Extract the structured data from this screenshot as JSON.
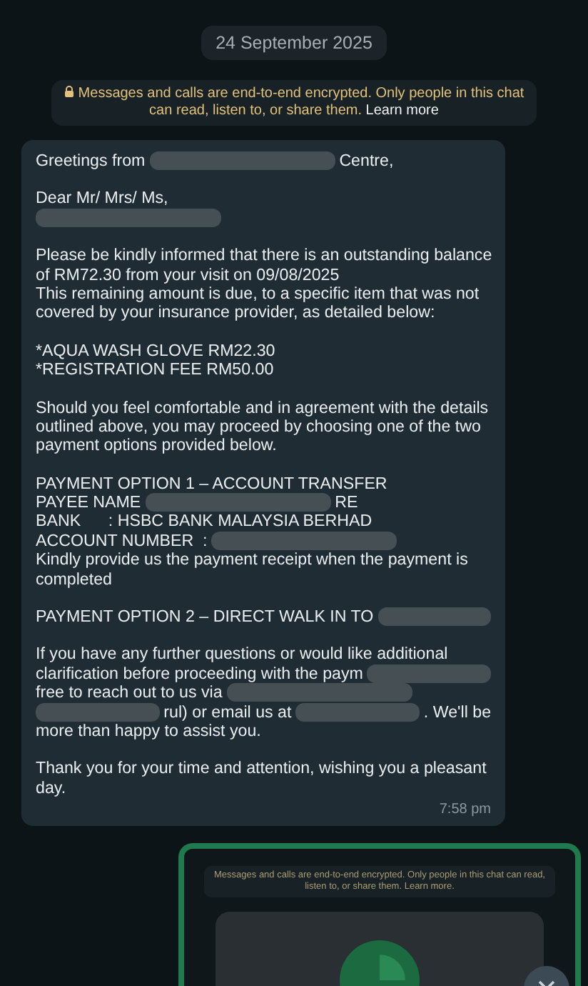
{
  "date_chip": "24 September 2025",
  "encryption_notice": {
    "text": "Messages and calls are end-to-end encrypted. Only people in this chat can read, listen to, or share them.",
    "link": "Learn more"
  },
  "message": {
    "paragraphs": [
      {
        "lines": [
          [
            {
              "kind": "text",
              "text": "Greetings from"
            },
            {
              "kind": "redacted"
            },
            {
              "kind": "text",
              "text": "Centre,"
            }
          ]
        ]
      },
      {
        "lines": [
          [
            {
              "kind": "text",
              "text": "Dear Mr/ Mrs/ Ms,"
            }
          ],
          [
            {
              "kind": "redacted"
            }
          ]
        ]
      },
      {
        "lines": [
          [
            {
              "kind": "text",
              "text": "Please be kindly informed that there is an outstanding balance"
            }
          ],
          [
            {
              "kind": "text",
              "text": "of RM72.30 from your visit on 09/08/2025"
            }
          ],
          [
            {
              "kind": "text",
              "text": "This remaining amount is due, to a specific item that was not"
            }
          ],
          [
            {
              "kind": "text",
              "text": "covered by your insurance provider, as detailed below:"
            }
          ]
        ]
      },
      {
        "lines": [
          [
            {
              "kind": "text",
              "text": "*AQUA WASH GLOVE RM22.30"
            }
          ],
          [
            {
              "kind": "text",
              "text": "*REGISTRATION FEE RM50.00"
            }
          ]
        ]
      },
      {
        "lines": [
          [
            {
              "kind": "text",
              "text": "Should you feel comfortable and in agreement with the details"
            }
          ],
          [
            {
              "kind": "text",
              "text": "outlined above, you may proceed by choosing one of the two"
            }
          ],
          [
            {
              "kind": "text",
              "text": "payment options provided below."
            }
          ]
        ]
      },
      {
        "lines": [
          [
            {
              "kind": "text",
              "text": "PAYMENT OPTION 1 – ACCOUNT TRANSFER"
            }
          ],
          [
            {
              "kind": "text",
              "text": "PAYEE NAME"
            },
            {
              "kind": "redacted"
            },
            {
              "kind": "text",
              "text": "RE"
            }
          ],
          [
            {
              "kind": "text",
              "text": "BANK      : HSBC BANK MALAYSIA BERHAD"
            }
          ],
          [
            {
              "kind": "text",
              "text": "ACCOUNT NUMBER  :"
            },
            {
              "kind": "redacted"
            }
          ],
          [
            {
              "kind": "text",
              "text": "Kindly provide us the payment receipt when the payment is"
            }
          ],
          [
            {
              "kind": "text",
              "text": "completed"
            }
          ]
        ]
      },
      {
        "lines": [
          [
            {
              "kind": "text",
              "text": "PAYMENT OPTION 2 – DIRECT WALK IN TO"
            },
            {
              "kind": "redacted"
            }
          ]
        ]
      },
      {
        "lines": [
          [
            {
              "kind": "text",
              "text": "If you have any further questions or would like additional"
            }
          ],
          [
            {
              "kind": "text",
              "text": "clarification before proceeding with the paym"
            },
            {
              "kind": "redacted"
            }
          ],
          [
            {
              "kind": "text",
              "text": "free to reach out to us via"
            },
            {
              "kind": "redacted"
            }
          ],
          [
            {
              "kind": "redacted"
            },
            {
              "kind": "text",
              "text": "rul) or email us at"
            },
            {
              "kind": "redacted"
            },
            {
              "kind": "text",
              "text": ". We'll be"
            }
          ],
          [
            {
              "kind": "text",
              "text": "more than happy to assist you."
            }
          ]
        ]
      },
      {
        "lines": [
          [
            {
              "kind": "text",
              "text": "Thank you for your time and attention, wishing you a pleasant"
            }
          ],
          [
            {
              "kind": "text",
              "text": "day."
            }
          ]
        ]
      }
    ],
    "time": "7:58 pm"
  },
  "image_message": {
    "notice": "Messages and calls are end-to-end encrypted. Only people in this chat can read, listen to, or share them. Learn more."
  }
}
